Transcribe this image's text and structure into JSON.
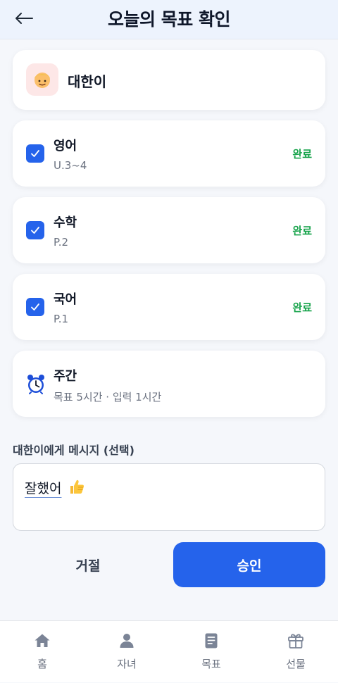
{
  "header": {
    "title": "오늘의 목표 확인"
  },
  "child": {
    "name": "대한이",
    "avatar_emoji": "👦"
  },
  "goals": [
    {
      "subject": "영어",
      "detail": "U.3~4",
      "status": "완료",
      "checked": true
    },
    {
      "subject": "수학",
      "detail": "P.2",
      "status": "완료",
      "checked": true
    },
    {
      "subject": "국어",
      "detail": "P.1",
      "status": "완료",
      "checked": true
    }
  ],
  "weekly": {
    "title": "주간",
    "detail": "목표 5시간 · 입력 1시간",
    "icon": "alarm-clock-icon"
  },
  "message": {
    "label": "대한이에게 메시지 (선택)",
    "value": "잘했어",
    "emoji": "thumbs-up"
  },
  "actions": {
    "reject_label": "거절",
    "approve_label": "승인"
  },
  "nav": [
    {
      "label": "홈",
      "icon": "home-icon"
    },
    {
      "label": "자녀",
      "icon": "person-icon"
    },
    {
      "label": "목표",
      "icon": "document-icon"
    },
    {
      "label": "선물",
      "icon": "gift-icon"
    }
  ],
  "colors": {
    "accent": "#2563eb",
    "done": "#16a34a",
    "header_bg": "#edf3fd",
    "page_bg": "#f5f7fb",
    "avatar_bg": "#fde7e7",
    "nav_icon": "#7b8496"
  }
}
